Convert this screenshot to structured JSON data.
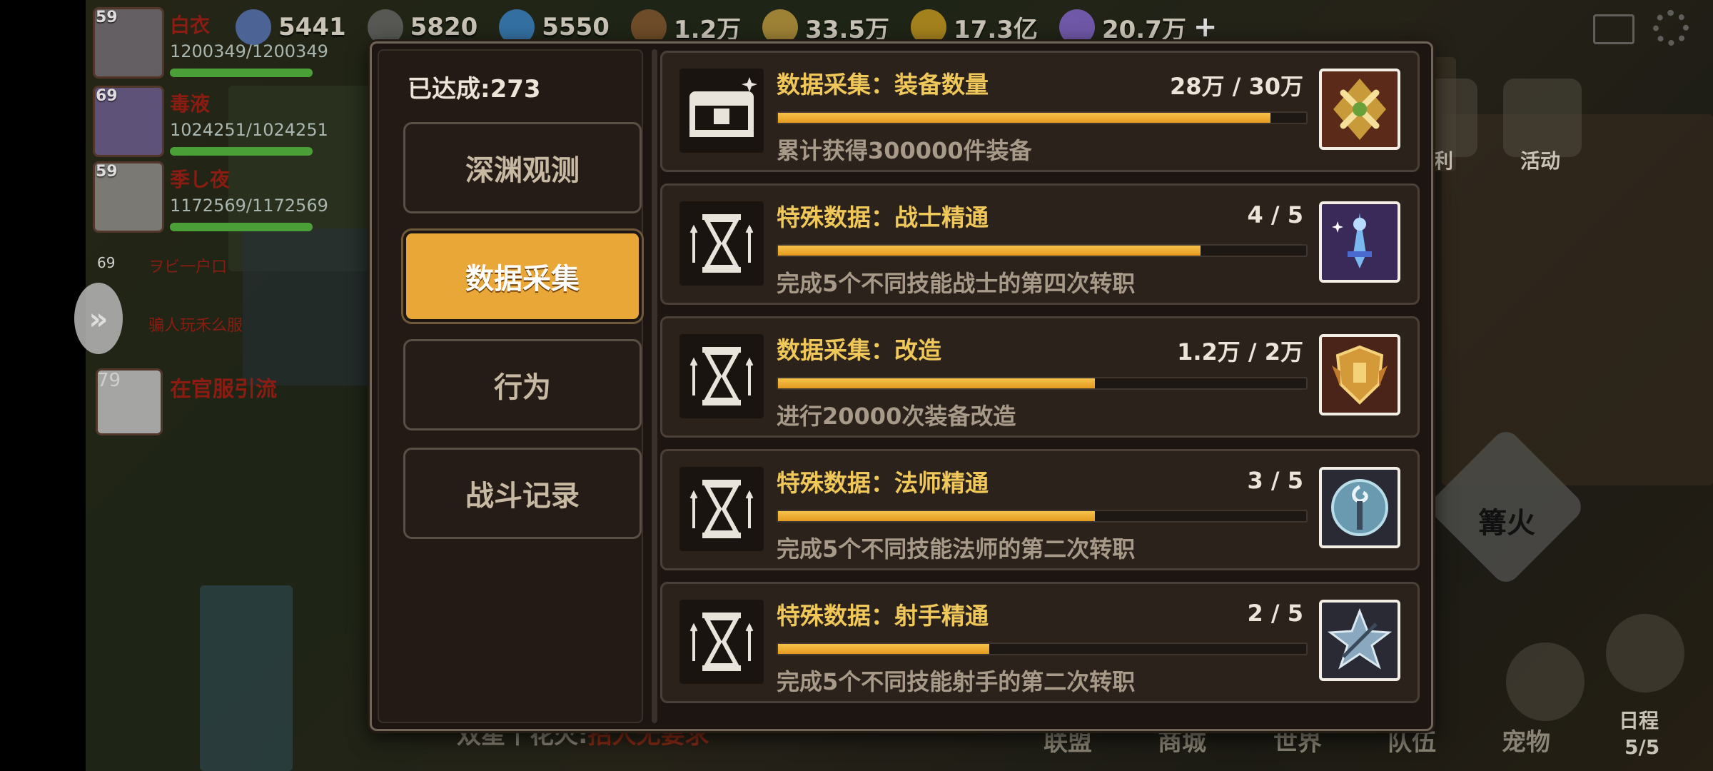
{
  "top_bar": {
    "resources": [
      {
        "icon": "crystal-icon",
        "value": "5441",
        "color": "#5a7ac0"
      },
      {
        "icon": "ore-icon",
        "value": "5820",
        "color": "#6a6a6a"
      },
      {
        "icon": "blue-crystal-icon",
        "value": "5550",
        "color": "#3a8ad0"
      },
      {
        "icon": "wood-icon",
        "value": "1.2万",
        "color": "#8a5a30"
      },
      {
        "icon": "wheat-icon",
        "value": "33.5万",
        "color": "#c8a040"
      },
      {
        "icon": "gold-coin-icon",
        "value": "17.3亿",
        "color": "#d0a020"
      },
      {
        "icon": "diamond-icon",
        "value": "20.7万",
        "color": "#8a6ad8"
      }
    ],
    "plus": "+"
  },
  "party": [
    {
      "level": "59",
      "name": "白衣",
      "hp": "1200349/1200349"
    },
    {
      "level": "69",
      "name": "毒液",
      "hp": "1024251/1024251"
    },
    {
      "level": "59",
      "name": "季し夜",
      "hp": "1172569/1172569"
    }
  ],
  "party_small": [
    {
      "level": "69",
      "name": "ヲビ一户口"
    },
    {
      "level": "",
      "name": "骗人玩禾么服"
    },
    {
      "level": "79",
      "name": "在官服引流"
    }
  ],
  "right_side": {
    "welfare": "福利",
    "activity": "活动",
    "bonfire": "篝火",
    "schedule": "日程",
    "schedule_count": "5/5"
  },
  "bottom_tabs": [
    "联盟",
    "商城",
    "世界",
    "队伍",
    "宠物"
  ],
  "chat": {
    "prefix": "双星丨花火:",
    "text": "招人无要求"
  },
  "dialog": {
    "achieved": "已达成:273",
    "categories": [
      {
        "label": "深渊观测",
        "active": false
      },
      {
        "label": "数据采集",
        "active": true
      },
      {
        "label": "行为",
        "active": false
      },
      {
        "label": "战斗记录",
        "active": false
      }
    ],
    "items": [
      {
        "icon": "chest-icon",
        "title": "数据采集：装备数量",
        "count": "28万 / 30万",
        "progress": 0.933,
        "desc": "累计获得300000件装备",
        "reward_icon": "crossed-swords-badge-icon"
      },
      {
        "icon": "hourglass-icon",
        "title": "特殊数据：战士精通",
        "count": "4 / 5",
        "progress": 0.8,
        "desc": "完成5个不同技能战士的第四次转职",
        "reward_icon": "blue-sword-badge-icon"
      },
      {
        "icon": "hourglass-icon",
        "title": "数据采集：改造",
        "count": "1.2万 / 2万",
        "progress": 0.6,
        "desc": "进行20000次装备改造",
        "reward_icon": "golden-shield-badge-icon"
      },
      {
        "icon": "hourglass-icon",
        "title": "特殊数据：法师精通",
        "count": "3 / 5",
        "progress": 0.6,
        "desc": "完成5个不同技能法师的第二次转职",
        "reward_icon": "mage-staff-badge-icon"
      },
      {
        "icon": "hourglass-icon",
        "title": "特殊数据：射手精通",
        "count": "2 / 5",
        "progress": 0.4,
        "desc": "完成5个不同技能射手的第二次转职",
        "reward_icon": "bow-star-badge-icon"
      }
    ]
  }
}
